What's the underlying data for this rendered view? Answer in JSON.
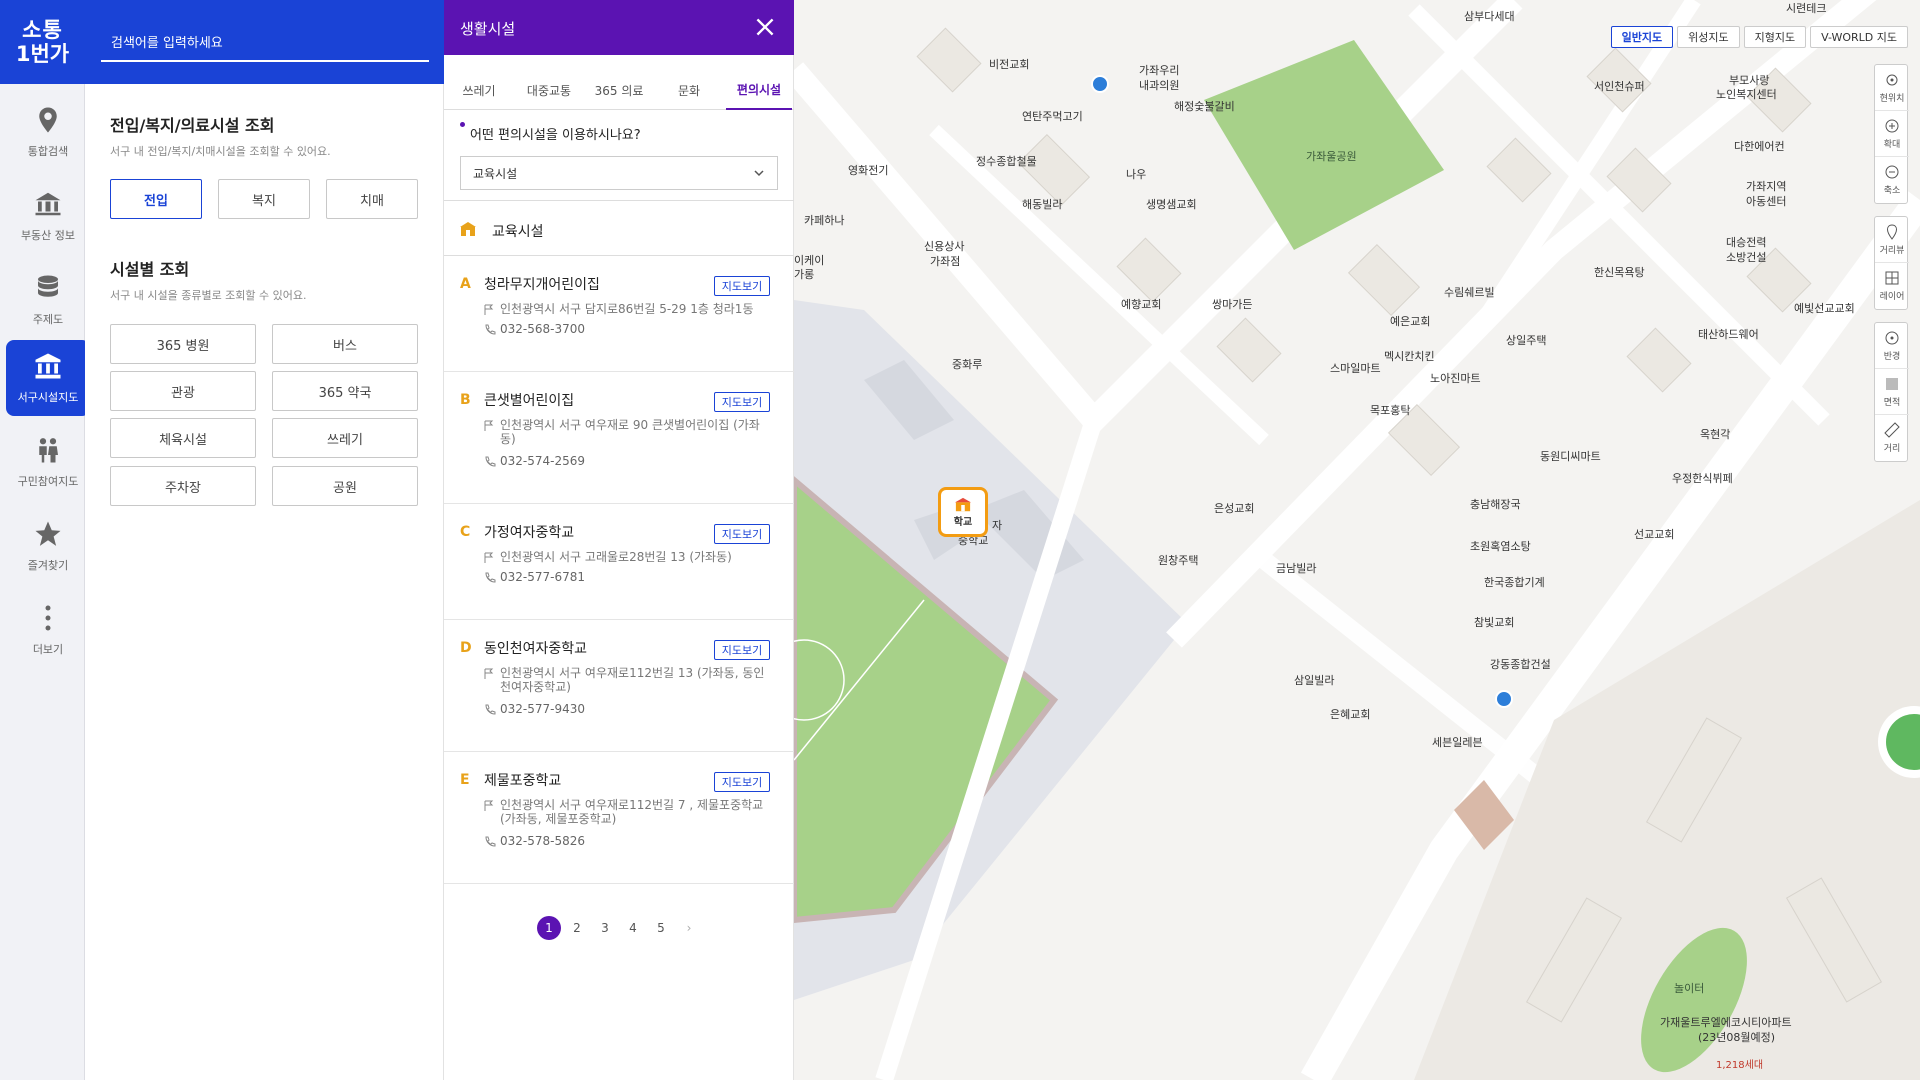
{
  "logo": {
    "line1": "소통",
    "line2": "1번가"
  },
  "rail": [
    {
      "label": "통합검색",
      "icon": "map-pin-icon"
    },
    {
      "label": "부동산 정보",
      "icon": "bank-building-icon"
    },
    {
      "label": "주제도",
      "icon": "database-icon"
    },
    {
      "label": "서구시설지도",
      "icon": "institution-icon"
    },
    {
      "label": "구민참여지도",
      "icon": "people-icon"
    },
    {
      "label": "즐겨찾기",
      "icon": "star-icon"
    },
    {
      "label": "더보기",
      "icon": "more-vertical-icon"
    }
  ],
  "search": {
    "placeholder": "검색어를 입력하세요"
  },
  "panel1": {
    "section1_title": "전입/복지/의료시설 조회",
    "section1_desc": "서구 내 전입/복지/치매시설을 조회할 수 있어요.",
    "section1_buttons": [
      "전입",
      "복지",
      "치매"
    ],
    "section2_title": "시설별 조회",
    "section2_desc": "서구 내 시설을 종류별로 조회할 수 있어요.",
    "section2_buttons": [
      "365 병원",
      "버스",
      "관광",
      "365 약국",
      "체육시설",
      "쓰레기",
      "주차장",
      "공원"
    ]
  },
  "panel2": {
    "title": "생활시설",
    "tabs": [
      "쓰레기",
      "대중교통",
      "365 의료",
      "문화",
      "편의시설"
    ],
    "question": "어떤 편의시설을 이용하시나요?",
    "select_value": "교육시설",
    "category": "교육시설",
    "map_button_label": "지도보기",
    "items": [
      {
        "letter": "A",
        "name": "청라무지개어린이집",
        "address": "인천광역시 서구 담지로86번길 5-29 1층 청라1동",
        "phone": "032-568-3700"
      },
      {
        "letter": "B",
        "name": "큰샛별어린이집",
        "address": "인천광역시 서구 여우재로 90 큰샛별어린이집 (가좌동)",
        "phone": "032-574-2569"
      },
      {
        "letter": "C",
        "name": "가정여자중학교",
        "address": "인천광역시 서구 고래울로28번길 13 (가좌동)",
        "phone": "032-577-6781"
      },
      {
        "letter": "D",
        "name": "동인천여자중학교",
        "address": "인천광역시 서구 여우재로112번길 13 (가좌동, 동인천여자중학교)",
        "phone": "032-577-9430"
      },
      {
        "letter": "E",
        "name": "제물포중학교",
        "address": "인천광역시 서구 여우재로112번길 7 , 제물포중학교 (가좌동, 제물포중학교)",
        "phone": "032-578-5826"
      }
    ],
    "pages": [
      "1",
      "2",
      "3",
      "4",
      "5",
      "›"
    ]
  },
  "map": {
    "types": [
      "일반지도",
      "위성지도",
      "지형지도",
      "V-WORLD 지도"
    ],
    "tools_group1": [
      "현위치",
      "확대",
      "축소"
    ],
    "tools_group2": [
      "거리뷰",
      "레이어"
    ],
    "tools_group3": [
      "반경",
      "면적",
      "거리"
    ],
    "marker_label": "학교",
    "labels": [
      {
        "t": "삼부다세대"
      },
      {
        "t": "시련테크"
      },
      {
        "t": "비전교회"
      },
      {
        "t": "가좌우리"
      },
      {
        "t": "내과의원"
      },
      {
        "t": "해정숯불갈비"
      },
      {
        "t": "가좌울공원"
      },
      {
        "t": "서인천슈퍼"
      },
      {
        "t": "부모사랑"
      },
      {
        "t": "노인복지센터"
      },
      {
        "t": "연탄주먹고기"
      },
      {
        "t": "정수종합철물"
      },
      {
        "t": "나우"
      },
      {
        "t": "생명샘교회"
      },
      {
        "t": "다한에어컨"
      },
      {
        "t": "가좌지역"
      },
      {
        "t": "아동센터"
      },
      {
        "t": "영화전기"
      },
      {
        "t": "해동빌라"
      },
      {
        "t": "카페하나"
      },
      {
        "t": "신용상사"
      },
      {
        "t": "가좌점"
      },
      {
        "t": "대승전력"
      },
      {
        "t": "소방건설"
      },
      {
        "t": "한신목욕탕"
      },
      {
        "t": "예향교회"
      },
      {
        "t": "쌍마가든"
      },
      {
        "t": "수림쉐르빌"
      },
      {
        "t": "예은교회"
      },
      {
        "t": "상일주택"
      },
      {
        "t": "멕시칸치킨"
      },
      {
        "t": "노아진마트"
      },
      {
        "t": "스마일마트"
      },
      {
        "t": "중화루"
      },
      {
        "t": "목포홍탁"
      },
      {
        "t": "예빛선교교회"
      },
      {
        "t": "태산하드웨어"
      },
      {
        "t": "옥현각"
      },
      {
        "t": "동원디씨마트"
      },
      {
        "t": "우정한식뷔페"
      },
      {
        "t": "은성교회"
      },
      {
        "t": "충남해장국"
      },
      {
        "t": "선교교회"
      },
      {
        "t": "원창주택"
      },
      {
        "t": "금남빌라"
      },
      {
        "t": "초원혹염소탕"
      },
      {
        "t": "한국종합기계"
      },
      {
        "t": "참빛교회"
      },
      {
        "t": "강동종합건설"
      },
      {
        "t": "삼일빌라"
      },
      {
        "t": "은혜교회"
      },
      {
        "t": "세븐일레븐"
      },
      {
        "t": "놀이터"
      },
      {
        "t": "가재울트루엘에코시티아파트"
      },
      {
        "t": "(23년08월예정)"
      },
      {
        "t": "1,218세대"
      },
      {
        "t": "자"
      },
      {
        "t": "중학교"
      },
      {
        "t": "이케이"
      },
      {
        "t": "가롱"
      }
    ]
  }
}
